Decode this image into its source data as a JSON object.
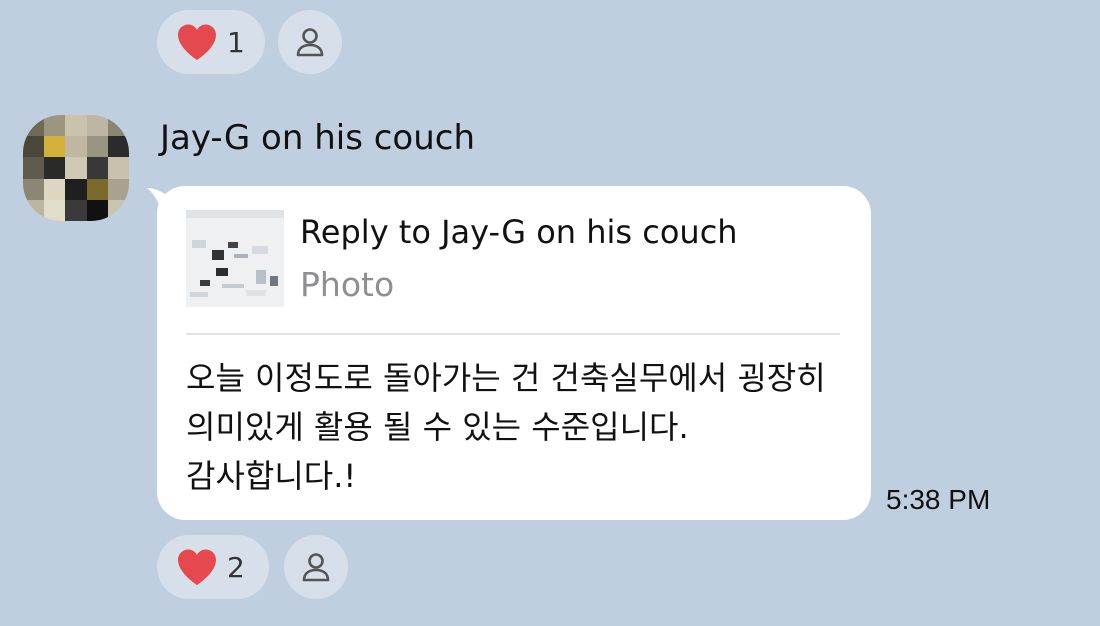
{
  "top_reactions": {
    "heart_count": "1"
  },
  "message": {
    "sender": "Jay-G on his couch",
    "reply": {
      "title": "Reply to Jay-G on his couch",
      "subtitle": "Photo"
    },
    "text": "오늘 이정도로 돌아가는 건 건축실무에서 굉장히 의미있게 활용 될 수 있는 수준입니다. 감사합니다.!",
    "time": "5:38 PM"
  },
  "bottom_reactions": {
    "heart_count": "2"
  },
  "colors": {
    "background": "#bfcfe0",
    "pill": "#d7e0ea",
    "bubble": "#ffffff",
    "heart": "#e5484d",
    "secondary_text": "#8e8e93"
  },
  "icons": {
    "reaction": "heart-icon",
    "add_reaction": "user-icon"
  }
}
